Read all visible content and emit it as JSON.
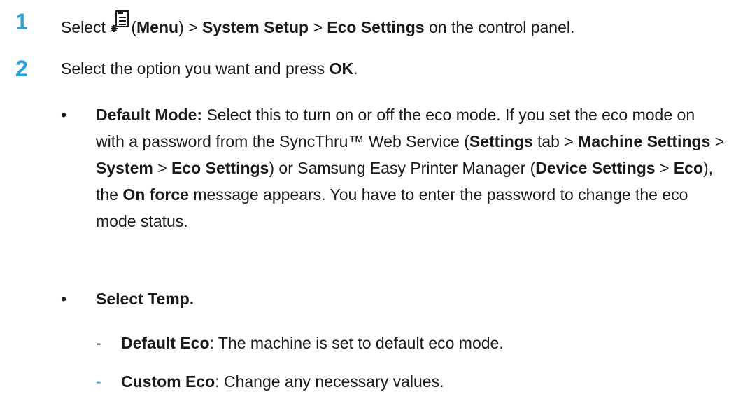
{
  "steps": [
    {
      "number": "1",
      "parts": {
        "p1": "Select",
        "menu_label": "Menu",
        "p2": ") >",
        "system_setup": "System Setup",
        "p3": ">",
        "eco_settings": "Eco Settings",
        "p4": "on the control panel."
      },
      "icon": "menu-icon"
    },
    {
      "number": "2",
      "parts": {
        "p1": "Select the option you want and press",
        "ok": "OK",
        "p2": "."
      }
    }
  ],
  "bullets": [
    {
      "title": "Default Mode:",
      "t1": "Select this to turn on or off the eco mode. If you set the eco mode on with a password from the SyncThru™ Web Service (",
      "settings": "Settings",
      "t2": "tab >",
      "machine_settings": "Machine Settings",
      "t3": ">",
      "system": "System",
      "t4": ">",
      "eco_settings": "Eco Settings",
      "t5": ") or Samsung Easy Printer Manager (",
      "device_settings": "Device Settings",
      "t6": ">",
      "eco": "Eco",
      "t7": "), the",
      "on_force": "On force",
      "t8": "message appears. You have to enter the password to change the eco mode status."
    },
    {
      "title": "Select Temp."
    }
  ],
  "sub_items": [
    {
      "dash": "-",
      "title": "Default Eco",
      "text": ": The machine is set to default eco mode."
    },
    {
      "dash": "-",
      "title": "Custom Eco",
      "text": ": Change any necessary values."
    }
  ],
  "bullet_char": "•",
  "colors": {
    "accent": "#2aa2d9",
    "text": "#1a1a1a"
  }
}
